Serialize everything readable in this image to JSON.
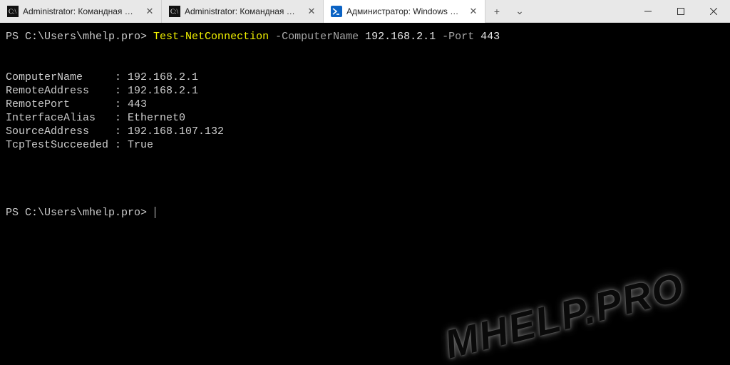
{
  "tabs": [
    {
      "label": "Administrator: Командная стро",
      "active": false,
      "icon": "cmd"
    },
    {
      "label": "Administrator: Командная стро",
      "active": false,
      "icon": "cmd"
    },
    {
      "label": "Администратор: Windows Pow",
      "active": true,
      "icon": "ps"
    }
  ],
  "newtab_glyph": "+",
  "dropdown_glyph": "⌄",
  "winbtns": {
    "min": "—",
    "max": "▢",
    "close": "✕"
  },
  "terminal": {
    "prompt1": "PS C:\\Users\\mhelp.pro> ",
    "cmd": "Test-NetConnection",
    "arg1": " -ComputerName ",
    "val1": "192.168.2.1",
    "arg2": " -Port ",
    "val2": "443",
    "results": [
      {
        "key": "ComputerName",
        "value": "192.168.2.1"
      },
      {
        "key": "RemoteAddress",
        "value": "192.168.2.1"
      },
      {
        "key": "RemotePort",
        "value": "443"
      },
      {
        "key": "InterfaceAlias",
        "value": "Ethernet0"
      },
      {
        "key": "SourceAddress",
        "value": "192.168.107.132"
      },
      {
        "key": "TcpTestSucceeded",
        "value": "True"
      }
    ],
    "prompt2": "PS C:\\Users\\mhelp.pro> "
  },
  "watermark": "MHELP.PRO"
}
